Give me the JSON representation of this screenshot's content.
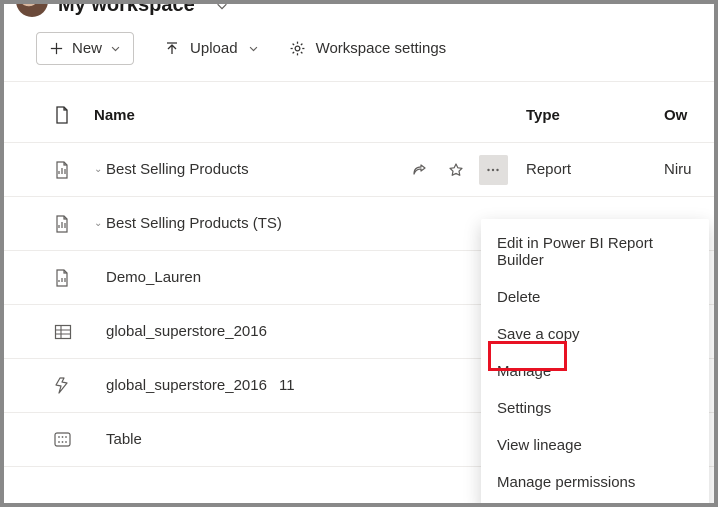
{
  "workspace": {
    "title": "My workspace"
  },
  "toolbar": {
    "new_label": "New",
    "upload_label": "Upload",
    "settings_label": "Workspace settings"
  },
  "columns": {
    "name": "Name",
    "type": "Type",
    "owner": "Ow"
  },
  "rows": [
    {
      "name": "Best Selling Products",
      "type": "Report",
      "owner": "Niru",
      "icon": "report",
      "tick": true,
      "actions": true
    },
    {
      "name": "Best Selling Products (TS)",
      "type": "",
      "owner": "",
      "icon": "report",
      "tick": true,
      "actions": false
    },
    {
      "name": "Demo_Lauren",
      "type": "",
      "owner": "",
      "icon": "report-alt",
      "tick": false,
      "actions": false
    },
    {
      "name": "global_superstore_2016",
      "type": "",
      "owner": "",
      "icon": "excel",
      "tick": false,
      "actions": false
    },
    {
      "name": "global_superstore_2016",
      "type": "",
      "owner": "",
      "icon": "flow",
      "tick": false,
      "actions": false,
      "count": "11"
    },
    {
      "name": "Table",
      "type": "",
      "owner": "",
      "icon": "table",
      "tick": false,
      "actions": false
    }
  ],
  "context_menu": {
    "items": [
      "Edit in Power BI Report Builder",
      "Delete",
      "Save a copy",
      "Manage",
      "Settings",
      "View lineage",
      "Manage permissions"
    ]
  }
}
